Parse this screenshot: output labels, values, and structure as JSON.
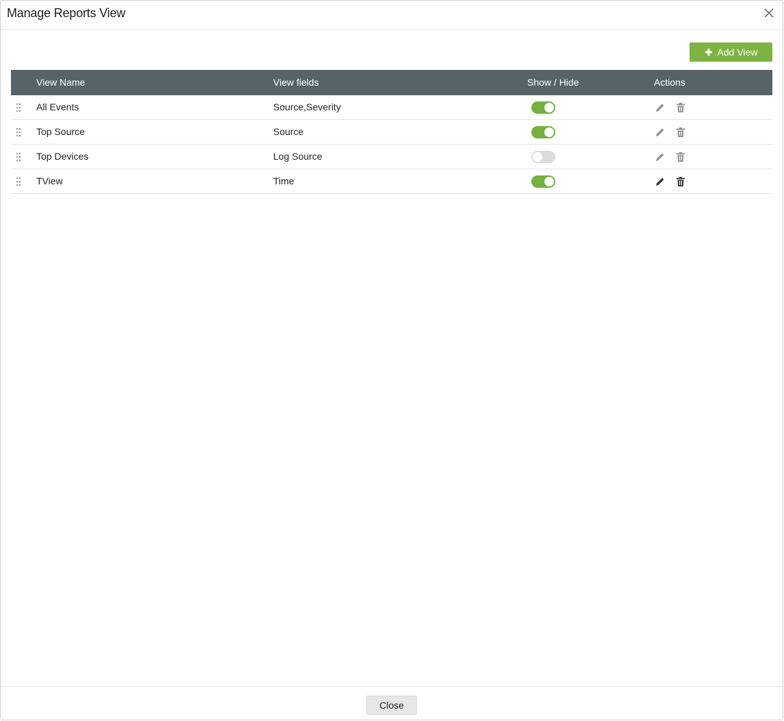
{
  "dialog": {
    "title": "Manage Reports View",
    "close_icon": "close-icon"
  },
  "toolbar": {
    "add_view_label": "Add View",
    "add_view_icon": "plus-icon",
    "accent_color": "#7cb342"
  },
  "table": {
    "header_color": "#566469",
    "columns": [
      "View Name",
      "View fields",
      "Show / Hide",
      "Actions"
    ],
    "rows": [
      {
        "name": "All Events",
        "fields": "Source,Severity",
        "visible": true,
        "actions_enabled": false
      },
      {
        "name": "Top Source",
        "fields": "Source",
        "visible": true,
        "actions_enabled": false
      },
      {
        "name": "Top Devices",
        "fields": "Log Source",
        "visible": false,
        "actions_enabled": false
      },
      {
        "name": "TView",
        "fields": "Time",
        "visible": true,
        "actions_enabled": true
      }
    ],
    "row_icons": {
      "drag": "drag-handle-icon",
      "edit": "pencil-icon",
      "delete": "trash-icon"
    }
  },
  "footer": {
    "close_label": "Close"
  }
}
